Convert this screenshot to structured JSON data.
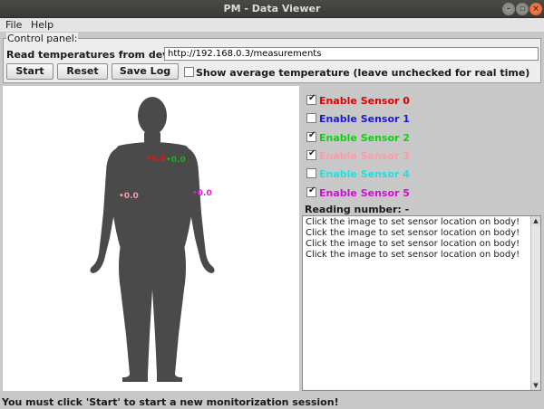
{
  "window": {
    "title": "PM - Data Viewer",
    "controls": [
      "minimize-icon",
      "maximize-icon",
      "close-icon"
    ]
  },
  "menu": {
    "items": [
      "File",
      "Help"
    ]
  },
  "control_panel": {
    "legend": "Control panel:",
    "read_label": "Read temperatures from device:",
    "url_value": "http://192.168.0.3/measurements",
    "buttons": {
      "start": "Start",
      "reset": "Reset",
      "save_log": "Save Log"
    },
    "avg_checkbox": {
      "label": "Show average temperature (leave unchecked for real time)",
      "checked": false
    }
  },
  "body_markers": [
    {
      "text": "0.0",
      "color": "#e01818"
    },
    {
      "text": "0.0",
      "color": "#18b418"
    },
    {
      "text": "0.0",
      "color": "#ff9aa8"
    },
    {
      "text": "0.0",
      "color": "#e018e0"
    }
  ],
  "sensors": [
    {
      "label": "Enable Sensor 0",
      "color": "#e00000",
      "checked": true
    },
    {
      "label": "Enable Sensor 1",
      "color": "#1a1ad0",
      "checked": false
    },
    {
      "label": "Enable Sensor 2",
      "color": "#10d010",
      "checked": true
    },
    {
      "label": "Enable Sensor 3",
      "color": "#ff9aa8",
      "checked": true
    },
    {
      "label": "Enable Sensor 4",
      "color": "#20e0e0",
      "checked": false
    },
    {
      "label": "Enable Sensor 5",
      "color": "#d010d0",
      "checked": true
    }
  ],
  "reading": {
    "label": "Reading number: -"
  },
  "log": {
    "lines": [
      "Click the image to set sensor location on body!",
      "Click the image to set sensor location on body!",
      "Click the image to set sensor location on body!",
      "Click the image to set sensor location on body!"
    ]
  },
  "status": "You must click 'Start' to start a new monitorization session!"
}
